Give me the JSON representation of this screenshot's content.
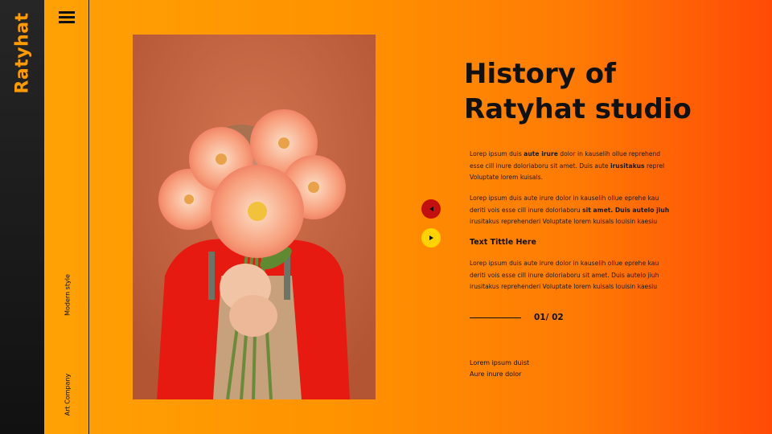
{
  "brand": {
    "name": "Ratyhat"
  },
  "rail": {
    "style_label": "Modern style",
    "company_label": "Art Company"
  },
  "main": {
    "title_line1": "History of",
    "title_line2": "Ratyhat studio",
    "paragraph1": [
      {
        "t": "Lorep  ipsum duis "
      },
      {
        "t": "aute irure",
        "b": true
      },
      {
        "t": " dolor in kauselih ollue reprehend esse cill inure doloriaboru sit amet. Duis aute "
      },
      {
        "t": "irusitakus",
        "b": true
      },
      {
        "t": " reprel Voluptate lorem kuisals."
      }
    ],
    "paragraph2": [
      {
        "t": "Lorep  ipsum duis aute irure dolor in kauselih ollue eprehe kau deriti vois esse cill inure doloriaboru "
      },
      {
        "t": "sit amet. Duis autelo jiuh",
        "b": true
      },
      {
        "t": " irusitakus reprehenderi Voluptate lorem kuisals louisin kaesiu"
      }
    ],
    "subheading": "Text Tittle Here",
    "paragraph3": [
      {
        "t": "Lorep  ipsum duis aute irure dolor in kauselih ollue eprehe kau deriti vois esse cill inure doloriaboru sit amet. Duis autelo jiuh irusitakus reprehenderi Voluptate lorem kuisals louisin kaesiu"
      }
    ],
    "page_counter": "01/ 02",
    "footer_line1": "Lorem ipsum  duist",
    "footer_line2": "Aure inure dolor"
  },
  "nav": {
    "prev_icon": "triangle-left-icon",
    "next_icon": "triangle-right-icon"
  },
  "colors": {
    "accent": "#ff9a00",
    "prev": "#c20f0f",
    "next": "#ffd200",
    "strip": "#1a1a1a"
  }
}
